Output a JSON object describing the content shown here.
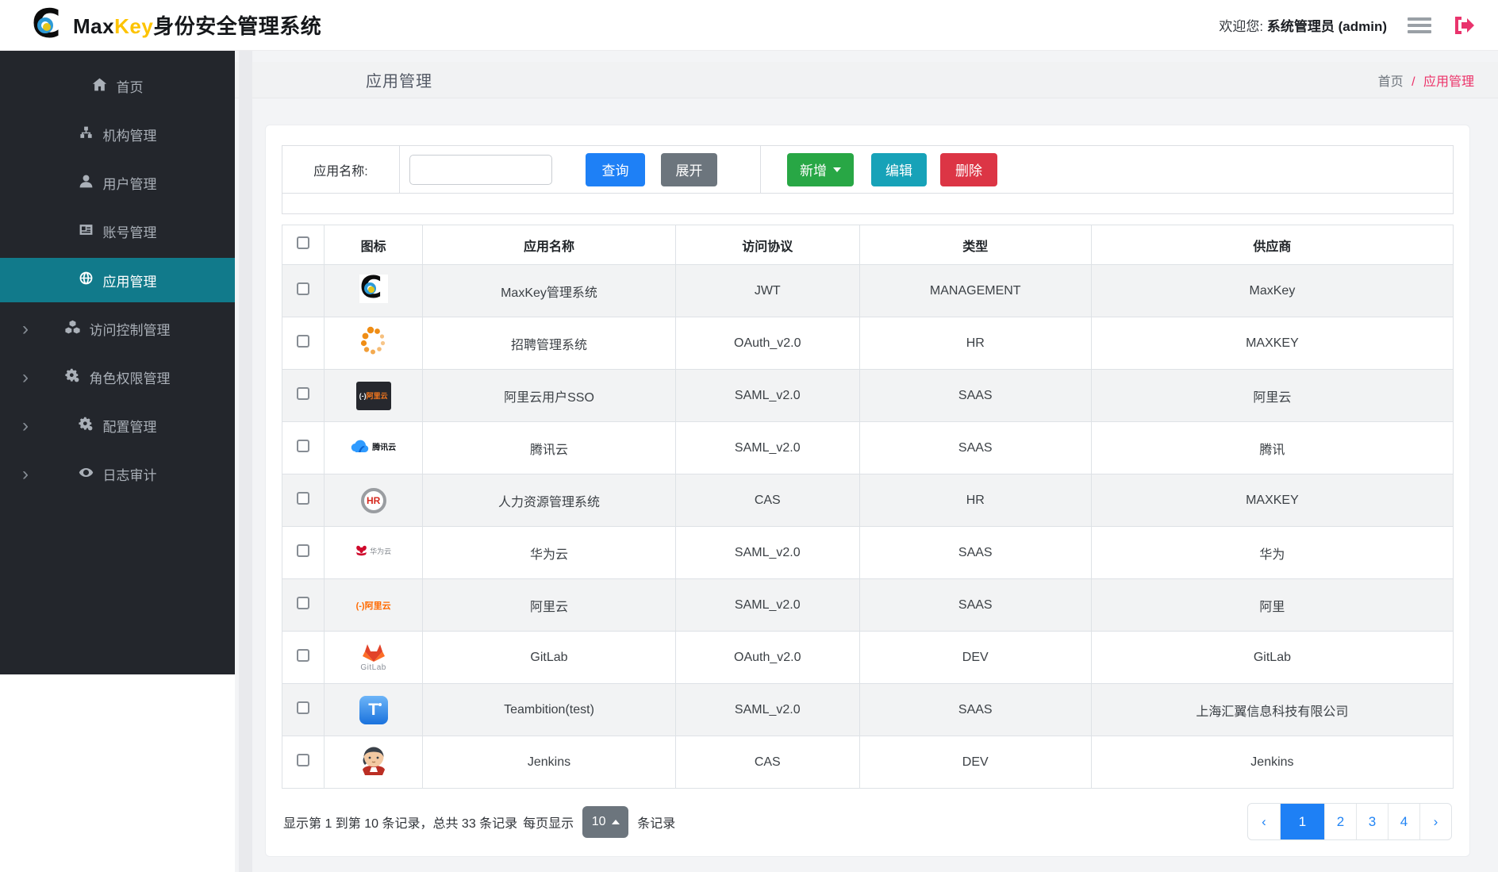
{
  "navbar": {
    "brand_max": "Max",
    "brand_key": "Key",
    "brand_suffix": "身份安全管理系统",
    "welcome_prefix": "欢迎您:",
    "welcome_user": "系统管理员 (admin)"
  },
  "sidebar": {
    "items": [
      {
        "label": "首页",
        "icon": "home-icon",
        "active": false,
        "expandable": false
      },
      {
        "label": "机构管理",
        "icon": "sitemap-icon",
        "active": false,
        "expandable": false
      },
      {
        "label": "用户管理",
        "icon": "user-icon",
        "active": false,
        "expandable": false
      },
      {
        "label": "账号管理",
        "icon": "id-card-icon",
        "active": false,
        "expandable": false
      },
      {
        "label": "应用管理",
        "icon": "globe-icon",
        "active": true,
        "expandable": false
      },
      {
        "label": "访问控制管理",
        "icon": "cubes-icon",
        "active": false,
        "expandable": true
      },
      {
        "label": "角色权限管理",
        "icon": "gears-icon",
        "active": false,
        "expandable": true
      },
      {
        "label": "配置管理",
        "icon": "gears-icon",
        "active": false,
        "expandable": true
      },
      {
        "label": "日志审计",
        "icon": "eye-icon",
        "active": false,
        "expandable": true
      }
    ]
  },
  "page_header": {
    "title": "应用管理",
    "breadcrumb_home": "首页",
    "breadcrumb_sep": "/",
    "breadcrumb_current": "应用管理"
  },
  "toolbar": {
    "search_label": "应用名称:",
    "search_value": "",
    "query_label": "查询",
    "expand_label": "展开",
    "add_label": "新增",
    "edit_label": "编辑",
    "delete_label": "删除"
  },
  "table": {
    "columns": [
      "图标",
      "应用名称",
      "访问协议",
      "类型",
      "供应商"
    ],
    "rows": [
      {
        "icon": "maxkey-bullseye-icon",
        "name": "MaxKey管理系统",
        "protocol": "JWT",
        "app_type": "MANAGEMENT",
        "vendor": "MaxKey"
      },
      {
        "icon": "orange-dot-spinner-icon",
        "name": "招聘管理系统",
        "protocol": "OAuth_v2.0",
        "app_type": "HR",
        "vendor": "MAXKEY"
      },
      {
        "icon": "alibaba-cloud-dark-icon",
        "name": "阿里云用户SSO",
        "protocol": "SAML_v2.0",
        "app_type": "SAAS",
        "vendor": "阿里云"
      },
      {
        "icon": "tencent-cloud-icon",
        "name": "腾讯云",
        "protocol": "SAML_v2.0",
        "app_type": "SAAS",
        "vendor": "腾讯"
      },
      {
        "icon": "hr-ring-icon",
        "name": "人力资源管理系统",
        "protocol": "CAS",
        "app_type": "HR",
        "vendor": "MAXKEY"
      },
      {
        "icon": "huawei-cloud-icon",
        "name": "华为云",
        "protocol": "SAML_v2.0",
        "app_type": "SAAS",
        "vendor": "华为"
      },
      {
        "icon": "alibaba-cloud-icon",
        "name": "阿里云",
        "protocol": "SAML_v2.0",
        "app_type": "SAAS",
        "vendor": "阿里"
      },
      {
        "icon": "gitlab-icon",
        "name": "GitLab",
        "protocol": "OAuth_v2.0",
        "app_type": "DEV",
        "vendor": "GitLab"
      },
      {
        "icon": "teambition-icon",
        "name": "Teambition(test)",
        "protocol": "SAML_v2.0",
        "app_type": "SAAS",
        "vendor": "上海汇翼信息科技有限公司"
      },
      {
        "icon": "jenkins-icon",
        "name": "Jenkins",
        "protocol": "CAS",
        "app_type": "DEV",
        "vendor": "Jenkins"
      }
    ],
    "icon_labels": {
      "alibaba_cloud_dark": "(-)阿里云",
      "alibaba_cloud": "(-)阿里云",
      "tencent_text": "腾讯云",
      "hr_text": "HR",
      "huawei_text": "华为云",
      "gitlab_text": "GitLab",
      "teambition_text": "T"
    }
  },
  "pagination": {
    "summary_left": "显示第 1 到第 10 条记录，总共 33 条记录",
    "per_page_prefix": "每页显示",
    "per_page_value": "10",
    "per_page_suffix": "条记录",
    "prev": "‹",
    "next": "›",
    "pages": [
      "1",
      "2",
      "3",
      "4"
    ],
    "active_page": "1"
  },
  "colors": {
    "sidebar_bg": "#23262c",
    "sidebar_active": "#117a8b",
    "brand_yellow": "#fdc300",
    "breadcrumb_pink": "#ec3168",
    "btn_query_blue": "#1e80f6",
    "btn_expand_gray": "#6c757d",
    "btn_add_green": "#28a745",
    "btn_edit_teal": "#17a2b8",
    "btn_delete_red": "#dc3545",
    "pager_active_blue": "#1e80f5",
    "logout_pink": "#e9346d"
  }
}
